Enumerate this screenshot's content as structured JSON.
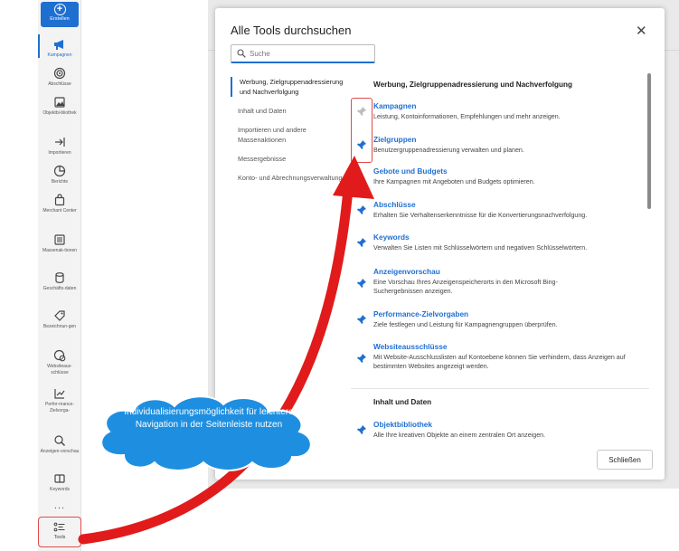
{
  "sidebar": {
    "create_label": "Erstellen",
    "items": [
      {
        "label": "Kampagnen",
        "icon": "megaphone-icon",
        "active": true
      },
      {
        "label": "Abschlüsse",
        "icon": "target-icon"
      },
      {
        "label": "Objektbi-bliothek",
        "icon": "image-library-icon"
      },
      {
        "label": "Importieren",
        "icon": "import-icon"
      },
      {
        "label": "Berichte",
        "icon": "chart-pie-icon"
      },
      {
        "label": "Merchant Center",
        "icon": "shopping-bag-icon"
      },
      {
        "label": "Massenak-tionen",
        "icon": "bulk-list-icon"
      },
      {
        "label": "Geschäfts-daten",
        "icon": "database-icon"
      },
      {
        "label": "Bezeichnun-gen",
        "icon": "tag-icon"
      },
      {
        "label": "Websiteaus-schlüsse",
        "icon": "globe-block-icon"
      },
      {
        "label": "Perfor-mance-Zielvorga-",
        "icon": "trend-chart-icon"
      },
      {
        "label": "Anzeigen-vorschau",
        "icon": "preview-search-icon"
      },
      {
        "label": "Keywords",
        "icon": "keywords-icon"
      }
    ],
    "more_label": "...",
    "tools_label": "Tools"
  },
  "modal": {
    "title": "Alle Tools durchsuchen",
    "search_placeholder": "Suche",
    "close_label": "Schließen",
    "categories": [
      "Werbung, Zielgruppenadressierung und Nachverfolgung",
      "Inhalt und Daten",
      "Importieren und andere Massenaktionen",
      "Messergebnisse",
      "Konto- und Abrechnungsverwaltung"
    ],
    "section1_title": "Werbung, Zielgruppenadressierung und Nachverfolgung",
    "section2_title": "Inhalt und Daten",
    "tools": [
      {
        "name": "Kampagnen",
        "desc": "Leistung, Kontoinformationen, Empfehlungen und mehr anzeigen.",
        "pinned": false
      },
      {
        "name": "Zielgruppen",
        "desc": "Benutzergruppenadressierung verwalten und planen.",
        "pinned": true
      },
      {
        "name": "Gebote und Budgets",
        "desc": "Ihre Kampagnen mit Angeboten und Budgets optimieren.",
        "pinned": false
      },
      {
        "name": "Abschlüsse",
        "desc": "Erhalten Sie Verhaltenserkenntnisse für die Konvertierungsnachverfolgung.",
        "pinned": true
      },
      {
        "name": "Keywords",
        "desc": "Verwalten Sie Listen mit Schlüsselwörtern und negativen Schlüsselwörtern.",
        "pinned": true
      },
      {
        "name": "Anzeigenvorschau",
        "desc": "Eine Vorschau Ihres Anzeigenspeicherorts in den Microsoft Bing-Suchergebnissen anzeigen.",
        "pinned": true
      },
      {
        "name": "Performance-Zielvorgaben",
        "desc": "Ziele festlegen und Leistung für Kampagnengruppen überprüfen.",
        "pinned": true
      },
      {
        "name": "Websiteausschlüsse",
        "desc": "Mit Website-Ausschlusslisten auf Kontoebene können Sie verhindern, dass Anzeigen auf bestimmten Websites angezeigt werden.",
        "pinned": true
      },
      {
        "name": "Objektbibliothek",
        "desc": "Alle Ihre kreativen Objekte an einem zentralen Ort anzeigen.",
        "pinned": true
      }
    ]
  },
  "annotation": {
    "text": "Individualisierungsmöglichkeit für leichtere Navigation in der Seitenleiste nutzen"
  },
  "colors": {
    "accent": "#1f6fd0",
    "annotation_red": "#e11b1b",
    "cloud_blue": "#1e8fe0"
  }
}
